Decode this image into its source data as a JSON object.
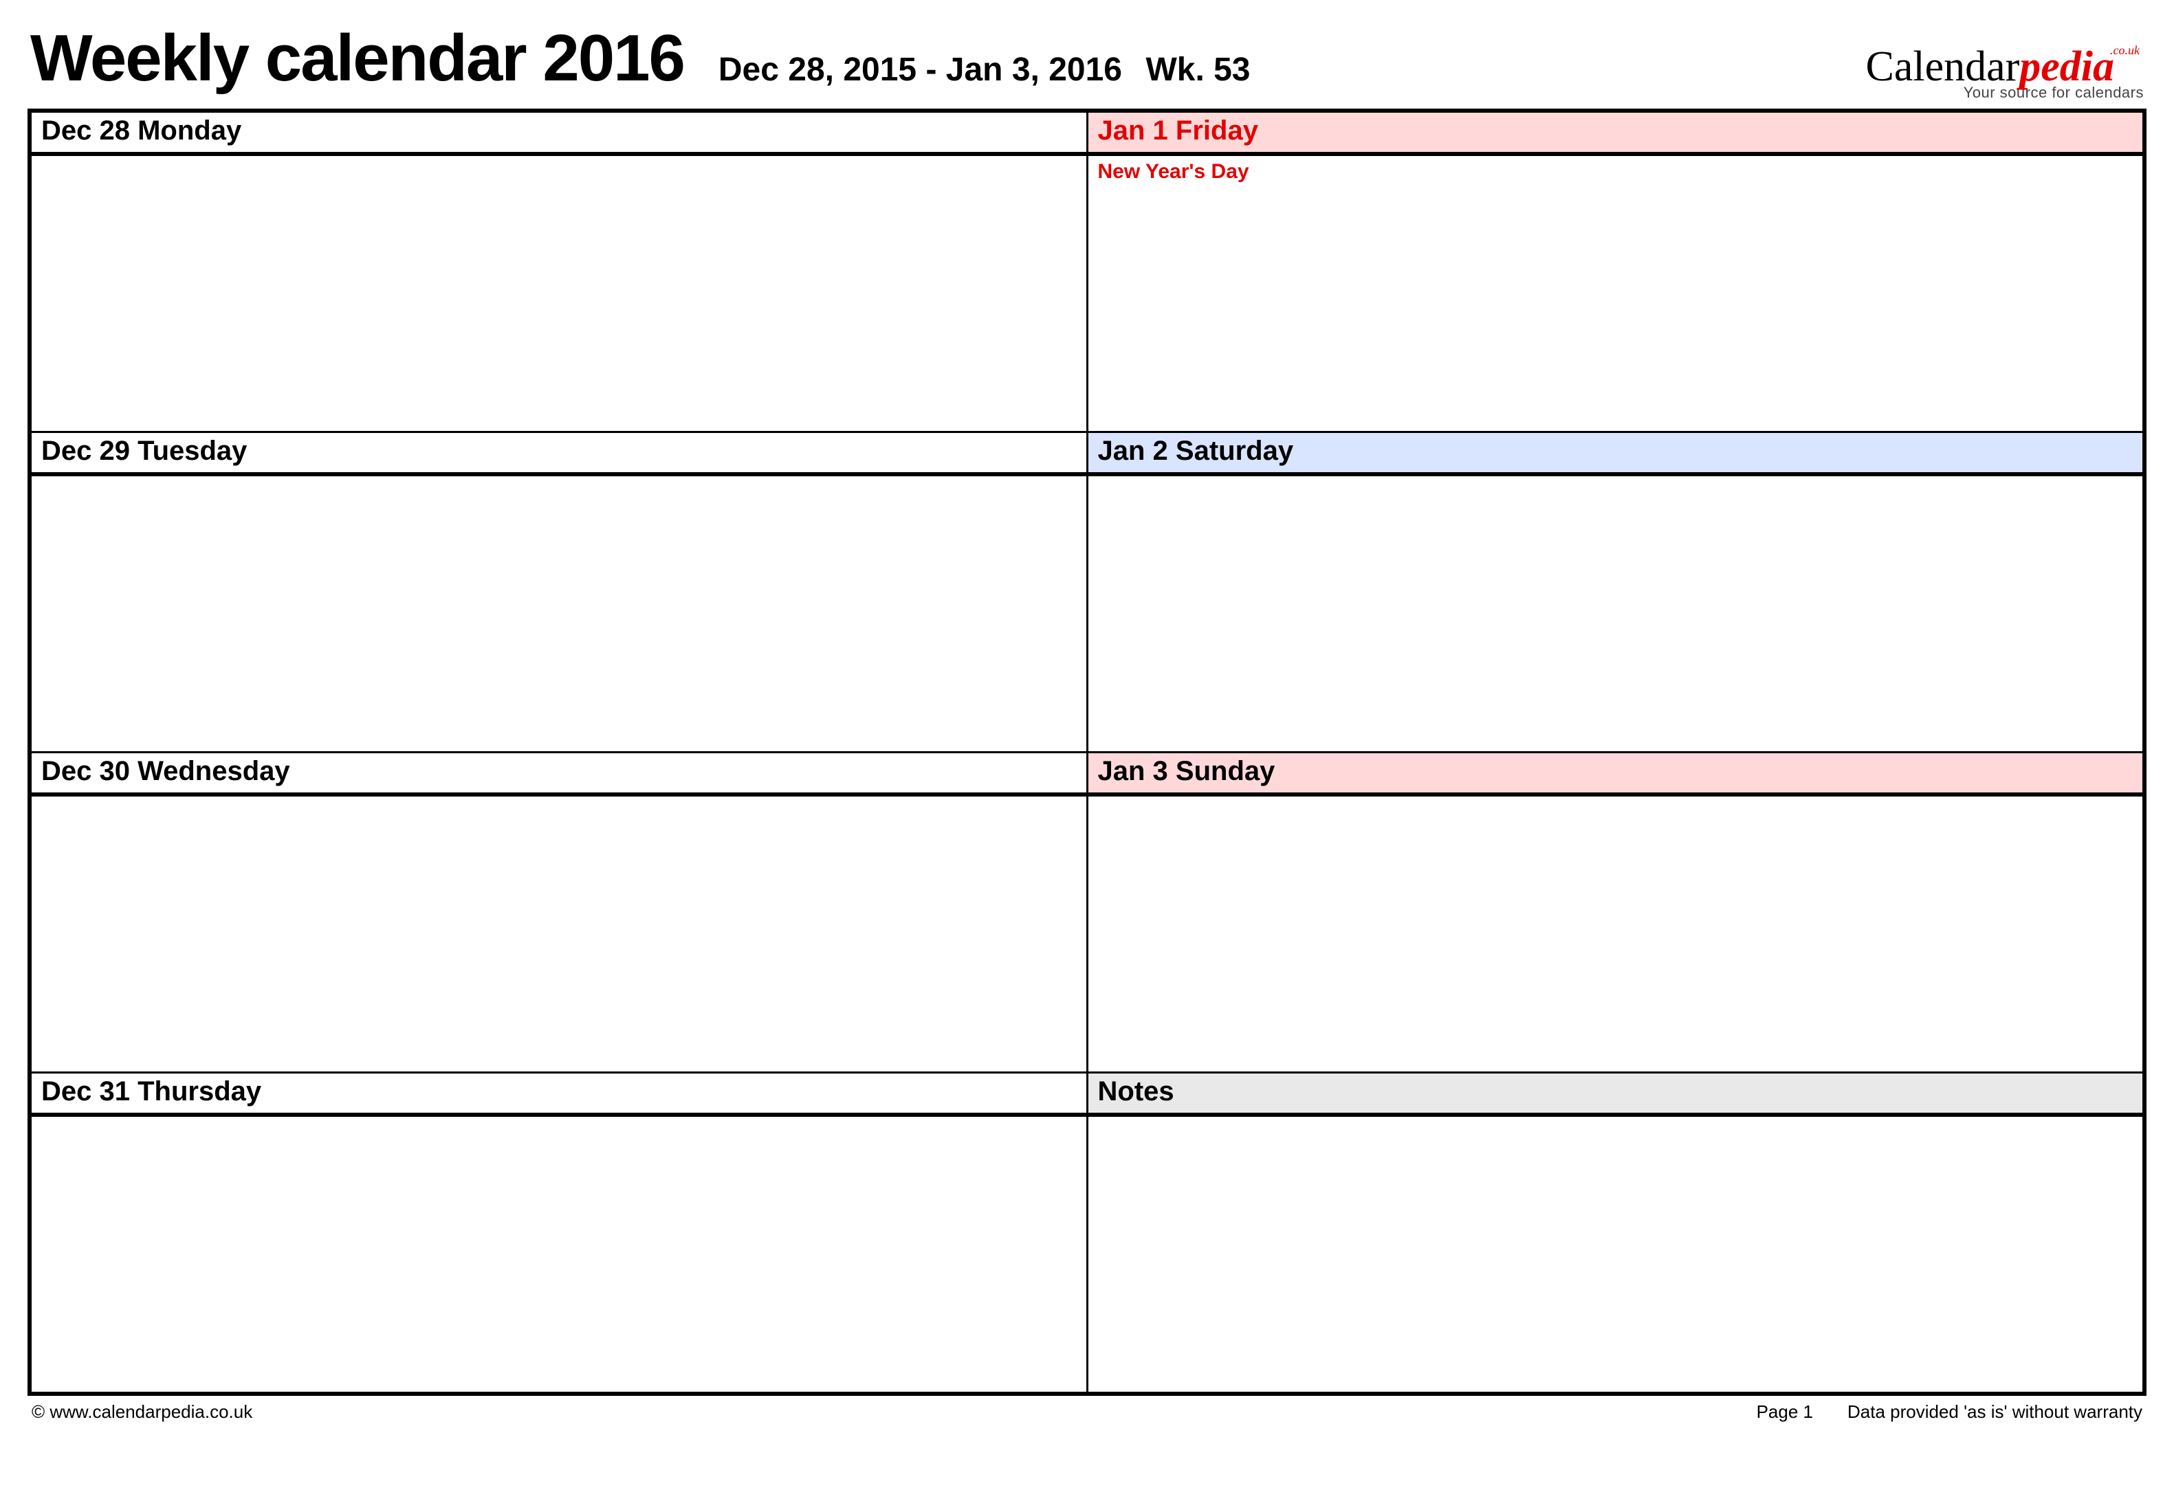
{
  "header": {
    "title": "Weekly calendar 2016",
    "date_range": "Dec 28, 2015 - Jan 3, 2016",
    "week": "Wk. 53"
  },
  "logo": {
    "part1": "Calendar",
    "part2": "pedia",
    "tld": ".co.uk",
    "tagline": "Your source for calendars"
  },
  "days": {
    "left": [
      {
        "label": "Dec 28  Monday",
        "event": ""
      },
      {
        "label": "Dec 29  Tuesday",
        "event": ""
      },
      {
        "label": "Dec 30  Wednesday",
        "event": ""
      },
      {
        "label": "Dec 31  Thursday",
        "event": ""
      }
    ],
    "right": [
      {
        "label": "Jan 1  Friday",
        "event": "New Year's Day",
        "header_bg": "red-bg",
        "header_text": "red-text"
      },
      {
        "label": "Jan 2  Saturday",
        "event": "",
        "header_bg": "blue-bg"
      },
      {
        "label": "Jan 3  Sunday",
        "event": "",
        "header_bg": "red-bg"
      },
      {
        "label": "Notes",
        "event": "",
        "header_bg": "gray-bg"
      }
    ]
  },
  "footer": {
    "copyright": "© www.calendarpedia.co.uk",
    "page": "Page 1",
    "warranty": "Data provided 'as is' without warranty"
  }
}
